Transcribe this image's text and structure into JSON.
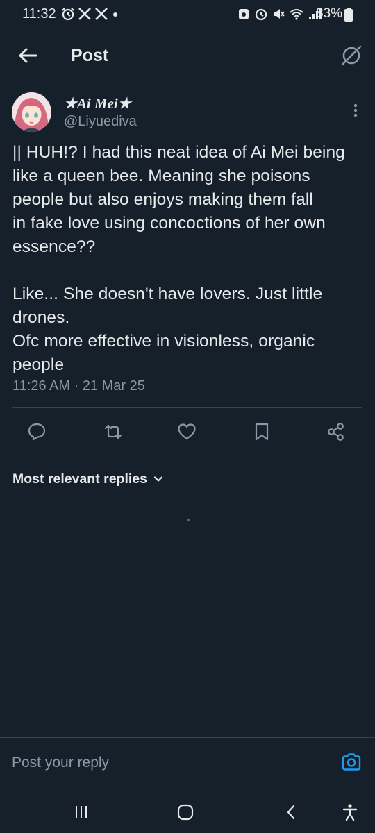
{
  "status_bar": {
    "time": "11:32",
    "battery": "83%"
  },
  "header": {
    "title": "Post"
  },
  "post": {
    "display_name": "★Ai Mei★",
    "username": "@Liyuediva",
    "text": "|| HUH!? I had this neat idea of Ai Mei being\nlike a queen bee. Meaning she poisons\npeople but also enjoys making them fall\nin fake love using concoctions of her own\nessence??\n\nLike... She doesn't have lovers. Just little\ndrones.\nOfc more effective in visionless, organic\npeople",
    "timestamp": "11:26 AM · 21 Mar 25"
  },
  "replies": {
    "filter_label": "Most relevant replies"
  },
  "composer": {
    "placeholder": "Post your reply"
  },
  "colors": {
    "background": "#15202b",
    "text": "#e7e9ea",
    "secondary": "#8b98a5",
    "divider": "#38444d",
    "accent": "#1d9bf0"
  }
}
